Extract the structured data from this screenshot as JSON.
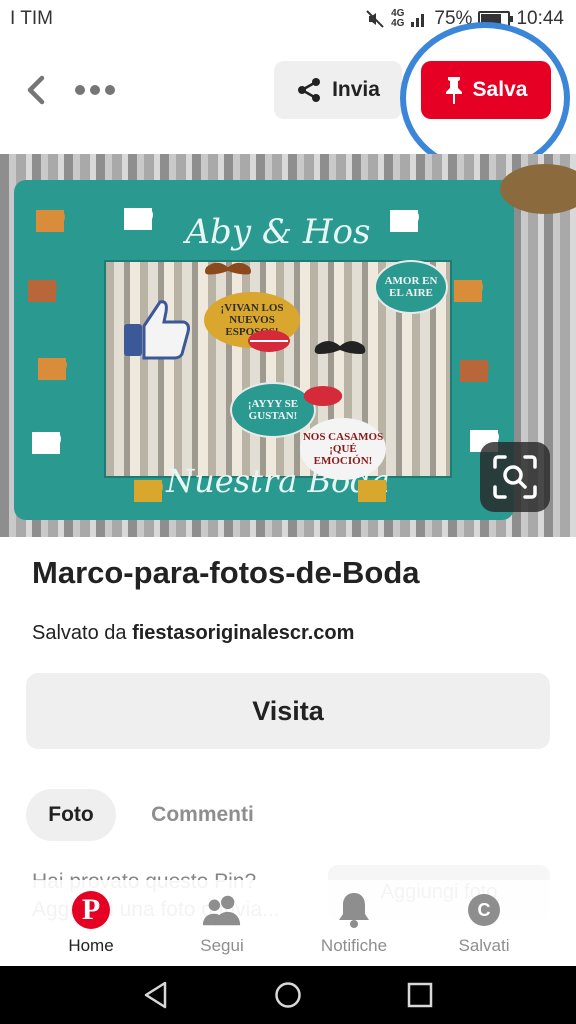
{
  "status_bar": {
    "carrier": "I TIM",
    "network_badge_top": "4G",
    "network_badge_bottom": "4G",
    "battery_percent": "75%",
    "battery_level": 0.75,
    "time": "10:44"
  },
  "header": {
    "back_icon": "chevron-left-icon",
    "more_icon": "ellipsis-icon",
    "send_label": "Invia",
    "save_label": "Salva",
    "accent_color": "#e60023",
    "annotation_color": "#3b86d8"
  },
  "pin_image": {
    "frame_title": "Aby & Hos",
    "frame_footer": "Nuestra Boda",
    "sign_amor": "AMOR EN EL AIRE",
    "sign_vivan": "¡VIVAN LOS NUEVOS ESPOSOS!",
    "sign_ayyy": "¡AYYY SE GUSTAN!",
    "sign_nos": "NOS CASAMOS ¡QUÉ EMOCIÓN!",
    "zoom_icon": "visual-search-icon"
  },
  "pin": {
    "title": "Marco-para-fotos-de-Boda",
    "saved_from_prefix": "Salvato da",
    "saved_from_source": "fiestasoriginalescr.com",
    "visit_label": "Visita"
  },
  "tabs": [
    {
      "label": "Foto",
      "active": true
    },
    {
      "label": "Commenti",
      "active": false
    }
  ],
  "tried": {
    "question": "Hai provato questo Pin? Aggiungi una foto o invia...",
    "button": "Aggiungi foto"
  },
  "bottom_nav": {
    "items": [
      {
        "label": "Home",
        "icon": "pinterest-logo-icon",
        "active": true
      },
      {
        "label": "Segui",
        "icon": "people-icon",
        "active": false
      },
      {
        "label": "Notifiche",
        "icon": "bell-icon",
        "active": false
      },
      {
        "label": "Salvati",
        "icon": "profile-avatar-icon",
        "avatar_letter": "C",
        "active": false
      }
    ]
  },
  "android_nav": {
    "back_icon": "triangle-back-icon",
    "home_icon": "circle-home-icon",
    "recents_icon": "square-recents-icon"
  }
}
